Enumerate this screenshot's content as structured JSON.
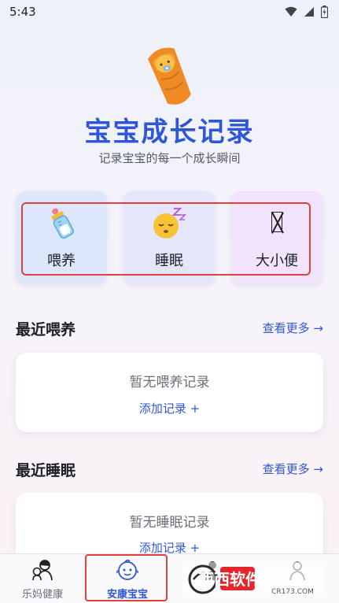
{
  "status_bar": {
    "time": "5:43",
    "icons": [
      "wifi-icon",
      "cellular-icon",
      "battery-icon"
    ]
  },
  "hero": {
    "logo_icon": "swaddled-baby-icon",
    "title": "宝宝成长记录",
    "subtitle": "记录宝宝的每一个成长瞬间"
  },
  "quick_actions": [
    {
      "label": "喂养",
      "icon": "baby-bottle-icon"
    },
    {
      "label": "睡眠",
      "icon": "sleeping-face-icon"
    },
    {
      "label": "大小便",
      "icon": "missing-glyph-icon"
    }
  ],
  "sections": {
    "feeding": {
      "title": "最近喂养",
      "see_more": "查看更多 →",
      "empty_text": "暂无喂养记录",
      "add_link": "添加记录 +"
    },
    "sleep": {
      "title": "最近睡眠",
      "see_more": "查看更多 →",
      "empty_text": "暂无睡眠记录",
      "add_link": "添加记录 +"
    }
  },
  "bottom_nav": {
    "items": [
      {
        "label": "乐妈健康",
        "icon": "mother-baby-icon",
        "active": false
      },
      {
        "label": "安康宝宝",
        "icon": "baby-face-icon",
        "active": true
      },
      {
        "label": "",
        "icon": "person-icon",
        "active": false
      },
      {
        "label": "",
        "icon": "profile-icon",
        "active": false
      }
    ]
  },
  "watermark": {
    "brand_text": "西西软件园",
    "url_text": "CR173.COM"
  },
  "colors": {
    "accent": "#2f56d6",
    "highlight": "#e0413a",
    "feed_card": "#dde7fb",
    "sleep_card": "#e5e6fb",
    "potty_card": "#f0e3fb"
  }
}
